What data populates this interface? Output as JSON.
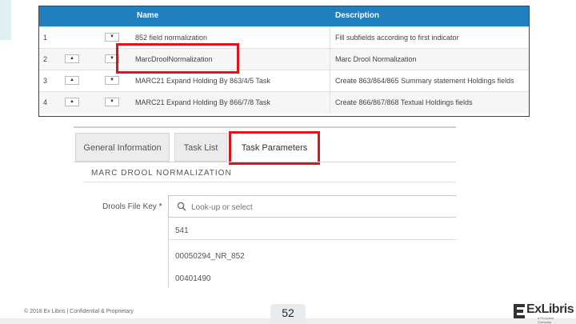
{
  "task_table": {
    "columns": [
      "Name",
      "Description"
    ],
    "rows": [
      {
        "num": "1",
        "name": "852 field normalization",
        "description": "Fill subfields according to first indicator",
        "up": false,
        "down": true
      },
      {
        "num": "2",
        "name": "MarcDroolNormalization",
        "description": "Marc Drool Normalization",
        "up": true,
        "down": true
      },
      {
        "num": "3",
        "name": "MARC21 Expand Holding By 863/4/5 Task",
        "description": "Create 863/864/865 Summary statement Holdings fields",
        "up": true,
        "down": true
      },
      {
        "num": "4",
        "name": "MARC21 Expand Holding By 866/7/8 Task",
        "description": "Create 866/867/868 Textual Holdings fields",
        "up": true,
        "down": true
      }
    ]
  },
  "tabs": [
    {
      "label": "General Information"
    },
    {
      "label": "Task List"
    },
    {
      "label": "Task Parameters"
    }
  ],
  "section_title": "MARC DROOL NORMALIZATION",
  "form": {
    "label": "Drools File Key",
    "required_mark": "*",
    "placeholder": "Look-up or select",
    "options": [
      "541",
      "00050294_NR_852",
      "00401490"
    ]
  },
  "footer": {
    "copyright": "© 2018 Ex Libris | Confidential & Proprietary",
    "page_number": "52",
    "logo_text": "ExLibris",
    "logo_sub": "a ProQuest Company"
  },
  "colors": {
    "header_blue": "#1f7fbf",
    "highlight_red": "#e0121b"
  }
}
